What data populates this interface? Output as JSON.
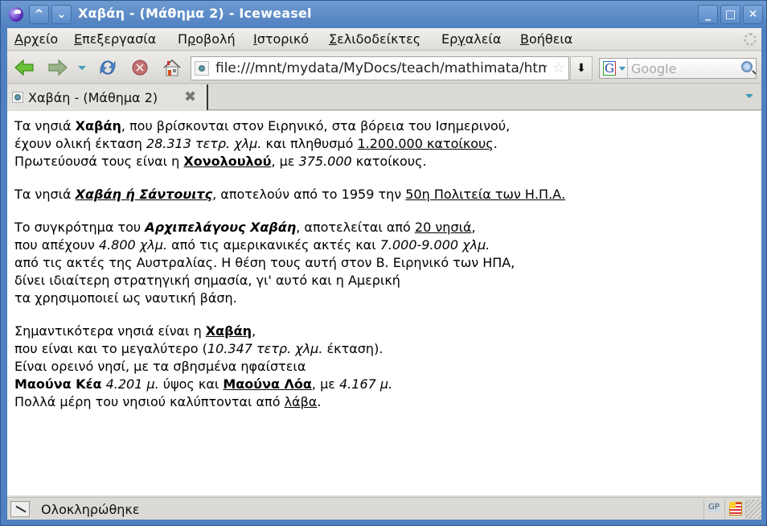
{
  "window": {
    "title": "Χαβάη - (Μάθημα 2) - Iceweasel",
    "controls": {
      "shade_up": "^",
      "shade_down": "⌄",
      "minimize": "_",
      "maximize": "□",
      "close": "✕"
    }
  },
  "menubar": {
    "items": [
      {
        "label": "Αρχείο",
        "accel": "Α"
      },
      {
        "label": "Επεξεργασία",
        "accel": "Ε"
      },
      {
        "label": "Προβολή",
        "accel": "ρ"
      },
      {
        "label": "Ιστορικό",
        "accel": "Ι"
      },
      {
        "label": "Σελιδοδείκτες",
        "accel": "Σ"
      },
      {
        "label": "Εργαλεία",
        "accel": "γ"
      },
      {
        "label": "Βοήθεια",
        "accel": "Β"
      }
    ]
  },
  "navbar": {
    "icons": [
      "back-arrow-icon",
      "forward-arrow-icon",
      "history-dropdown-icon",
      "reload-icon",
      "stop-icon",
      "home-icon"
    ],
    "url": "file:///mnt/mydata/MyDocs/teach/mathimata/html",
    "go_glyph": "⬇",
    "search": {
      "engine": "G",
      "placeholder": "Google",
      "value": ""
    }
  },
  "tabs": [
    {
      "title": "Χαβάη - (Μάθημα 2)",
      "active": true
    }
  ],
  "content": {
    "paragraphs": [
      {
        "lines": [
          [
            {
              "t": "Τα νησιά "
            },
            {
              "t": "Χαβάη",
              "b": true
            },
            {
              "t": ", που βρίσκονται στον Ειρηνικό, στα βόρεια του Ισημερινού,"
            }
          ],
          [
            {
              "t": "έχουν ολική έκταση "
            },
            {
              "t": "28.313 τετρ. χλμ.",
              "i": true
            },
            {
              "t": " και πληθυσμό "
            },
            {
              "t": "1.200.000 κατοίκους",
              "u": true
            },
            {
              "t": "."
            }
          ],
          [
            {
              "t": "Πρωτεύουσά τους είναι η "
            },
            {
              "t": "Χονολουλού",
              "b": true,
              "u": true
            },
            {
              "t": ", με "
            },
            {
              "t": "375.000",
              "i": true
            },
            {
              "t": " κατοίκους."
            }
          ]
        ]
      },
      {
        "lines": [
          [
            {
              "t": "Τα νησιά "
            },
            {
              "t": "Χαβάη ή Σάντουιτς",
              "b": true,
              "i": true,
              "u": true
            },
            {
              "t": ", αποτελούν από το 1959 την "
            },
            {
              "t": "50η Πολιτεία των Η.Π.Α.",
              "u": true
            }
          ]
        ]
      },
      {
        "lines": [
          [
            {
              "t": "Το συγκρότημα του "
            },
            {
              "t": "Αρχιπελάγους Χαβάη",
              "b": true,
              "i": true
            },
            {
              "t": ", αποτελείται από "
            },
            {
              "t": "20 νησιά",
              "u": true
            },
            {
              "t": ","
            }
          ],
          [
            {
              "t": "που απέχουν "
            },
            {
              "t": "4.800 χλμ.",
              "i": true
            },
            {
              "t": " από τις αμερικανικές ακτές και "
            },
            {
              "t": "7.000-9.000 χλμ.",
              "i": true
            }
          ],
          [
            {
              "t": "από τις ακτές της Αυστραλίας. Η θέση τους αυτή στον Β. Ειρηνικό των ΗΠΑ,"
            }
          ],
          [
            {
              "t": "δίνει ιδιαίτερη στρατηγική σημασία, γι' αυτό και η Αμερική"
            }
          ],
          [
            {
              "t": "τα χρησιμοποιεί ως ναυτική βάση."
            }
          ]
        ]
      },
      {
        "lines": [
          [
            {
              "t": "Σημαντικότερα νησιά είναι η "
            },
            {
              "t": "Χαβάη",
              "b": true,
              "u": true
            },
            {
              "t": ","
            }
          ],
          [
            {
              "t": "που είναι και το μεγαλύτερο ("
            },
            {
              "t": "10.347 τετρ. χλμ.",
              "i": true
            },
            {
              "t": " έκταση)."
            }
          ],
          [
            {
              "t": "Είναι ορεινό νησί, με τα σβησμένα ηφαίστεια"
            }
          ],
          [
            {
              "t": "Μαούνα Κέα",
              "b": true
            },
            {
              "t": " "
            },
            {
              "t": "4.201 μ.",
              "i": true
            },
            {
              "t": " ύψος και "
            },
            {
              "t": "Μαούνα Λόα",
              "b": true,
              "u": true
            },
            {
              "t": ", με "
            },
            {
              "t": "4.167 μ.",
              "i": true
            }
          ],
          [
            {
              "t": "Πολλά μέρη του νησιού καλύπτονται από "
            },
            {
              "t": "λάβα",
              "u": true
            },
            {
              "t": "."
            }
          ]
        ]
      }
    ]
  },
  "statusbar": {
    "text": "Ολοκληρώθηκε",
    "gp_label": "GP"
  },
  "colors": {
    "titlebar": "#5b8cc9",
    "accent_dropdown": "#3a9ab8"
  }
}
